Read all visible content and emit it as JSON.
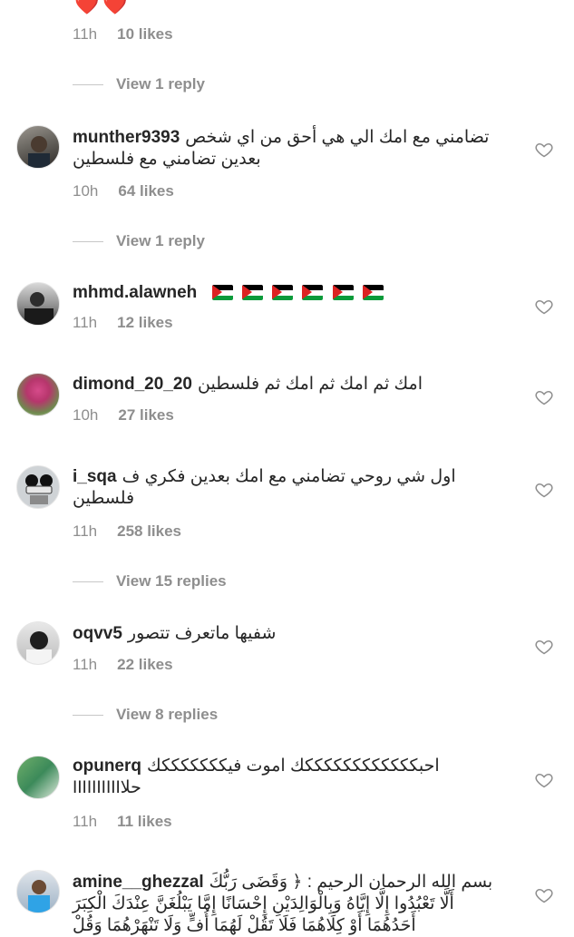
{
  "top_emojis": "❤️❤️",
  "top_meta": {
    "time": "11h",
    "likes": "10 likes"
  },
  "view_replies_1": "View 1 reply",
  "comments": [
    {
      "username": "munther9393",
      "text": "تضامني مع امك الي هي أحق من اي شخص بعدين تضامني مع فلسطين",
      "time": "10h",
      "likes": "64 likes"
    },
    {
      "username": "mhmd.alawneh",
      "text": "",
      "time": "11h",
      "likes": "12 likes"
    },
    {
      "username": "dimond_20_20",
      "text": "امك ثم امك ثم امك ثم فلسطين",
      "time": "10h",
      "likes": "27 likes"
    },
    {
      "username": "i_sqa",
      "text": "اول شي روحي تضامني مع امك بعدين فكري ف فلسطين",
      "time": "11h",
      "likes": "258 likes"
    },
    {
      "username": "oqvv5",
      "text": "شفيها ماتعرف تتصور",
      "time": "11h",
      "likes": "22 likes"
    },
    {
      "username": "opunerq",
      "text": "احبككككككككككككك اموت فيكككككككك حلاIIIIIIIIII",
      "time": "11h",
      "likes": "11 likes"
    },
    {
      "username": "amine__ghezzal",
      "text": "بسم الله الرحمان الرحيم : ﴿ وَقَضَى رَبُّكَ أَلَّا تَعْبُدُوا إِلَّا إِيَّاهُ وَبِالْوَالِدَيْنِ إِحْسَانًا إِمَّا يَبْلُغَنَّ عِنْدَكَ الْكِبَرَ أَحَدُهُمَا أَوْ كِلَاهُمَا فَلَا تَقُلْ لَهُمَا أُفٍّ وَلَا تَنْهَرْهُمَا وَقُلْ"
    }
  ],
  "view_replies_2": "View 1 reply",
  "view_replies_3": "View 15 replies",
  "view_replies_4": "View 8 replies",
  "colors": {
    "text": "#262626",
    "muted": "#8e8e8e",
    "heart": "#8e8e8e"
  },
  "flags": "palestine-flag ×6"
}
